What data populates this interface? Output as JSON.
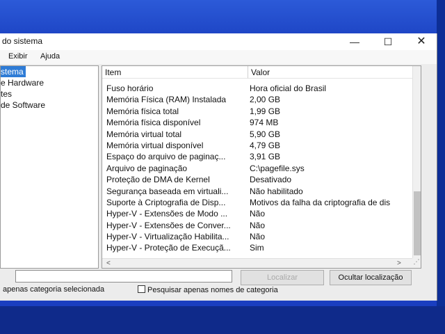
{
  "window": {
    "title": "do sistema",
    "controls": {
      "minimize": "—",
      "maximize": "☐",
      "close": "✕"
    }
  },
  "menu": [
    "Exibir",
    "Ajuda"
  ],
  "tree": {
    "items": [
      {
        "label": "stema",
        "selected": true
      },
      {
        "label": "e Hardware",
        "selected": false
      },
      {
        "label": "tes",
        "selected": false
      },
      {
        "label": "de Software",
        "selected": false
      }
    ]
  },
  "table": {
    "headers": {
      "item": "Item",
      "value": "Valor"
    },
    "rows": [
      {
        "item": "Fuso horário",
        "value": "Hora oficial do Brasil"
      },
      {
        "item": "Memória Física (RAM) Instalada",
        "value": "2,00 GB"
      },
      {
        "item": "Memória física total",
        "value": "1,99 GB"
      },
      {
        "item": "Memória física disponível",
        "value": "974 MB"
      },
      {
        "item": "Memória virtual total",
        "value": "5,90 GB"
      },
      {
        "item": "Memória virtual disponível",
        "value": "4,79 GB"
      },
      {
        "item": "Espaço do arquivo de paginaç...",
        "value": "3,91 GB"
      },
      {
        "item": "Arquivo de paginação",
        "value": "C:\\pagefile.sys"
      },
      {
        "item": "Proteção de DMA de Kernel",
        "value": "Desativado"
      },
      {
        "item": "Segurança baseada em virtuali...",
        "value": "Não habilitado"
      },
      {
        "item": "Suporte à Criptografia de Disp...",
        "value": "Motivos da falha da criptografia de dis"
      },
      {
        "item": "Hyper-V - Extensões de Modo ...",
        "value": "Não"
      },
      {
        "item": "Hyper-V - Extensões de Conver...",
        "value": "Não"
      },
      {
        "item": "Hyper-V - Virtualização Habilita...",
        "value": "Não"
      },
      {
        "item": "Hyper-V - Proteção de Execuçã...",
        "value": "Sim"
      }
    ]
  },
  "bottom": {
    "find_value": "",
    "find_button": "Localizar",
    "close_find_button": "Ocultar localização",
    "option_selected_category": "apenas categoria selecionada",
    "option_category_names": "Pesquisar apenas nomes de categoria"
  },
  "colors": {
    "selection": "#2f7cd6",
    "desktop": "#1a3ec0"
  }
}
